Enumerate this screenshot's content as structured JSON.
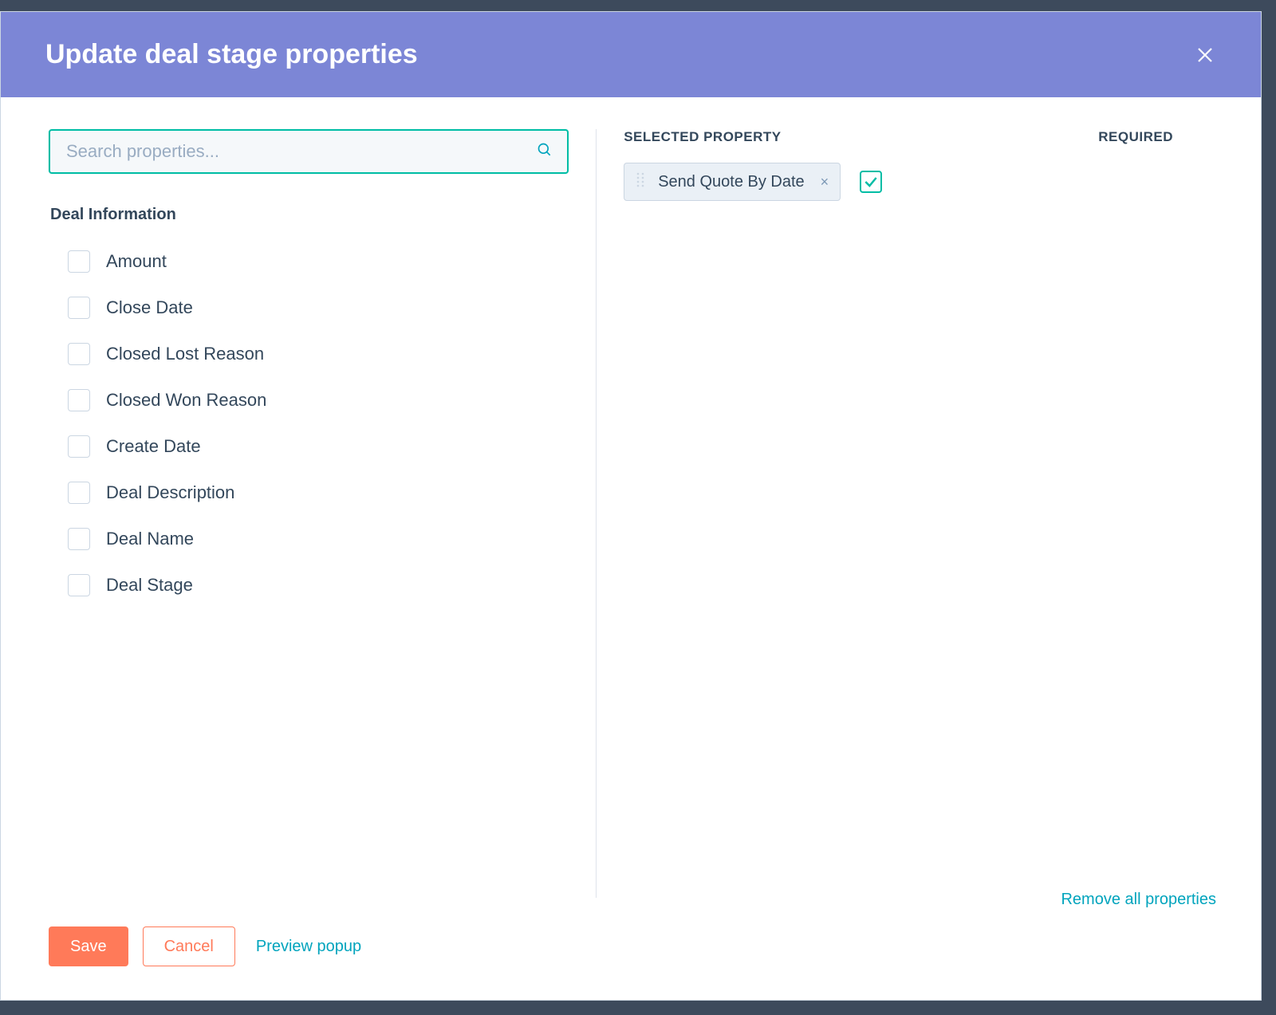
{
  "header": {
    "title": "Update deal stage properties"
  },
  "search": {
    "placeholder": "Search properties..."
  },
  "group": {
    "label": "Deal Information",
    "items": [
      {
        "label": "Amount"
      },
      {
        "label": "Close Date"
      },
      {
        "label": "Closed Lost Reason"
      },
      {
        "label": "Closed Won Reason"
      },
      {
        "label": "Create Date"
      },
      {
        "label": "Deal Description"
      },
      {
        "label": "Deal Name"
      },
      {
        "label": "Deal Stage"
      }
    ]
  },
  "rightPane": {
    "selectedHeading": "SELECTED PROPERTY",
    "requiredHeading": "REQUIRED",
    "selected": {
      "label": "Send Quote By Date",
      "required": true
    },
    "removeAll": "Remove all properties"
  },
  "footer": {
    "save": "Save",
    "cancel": "Cancel",
    "preview": "Preview popup"
  }
}
